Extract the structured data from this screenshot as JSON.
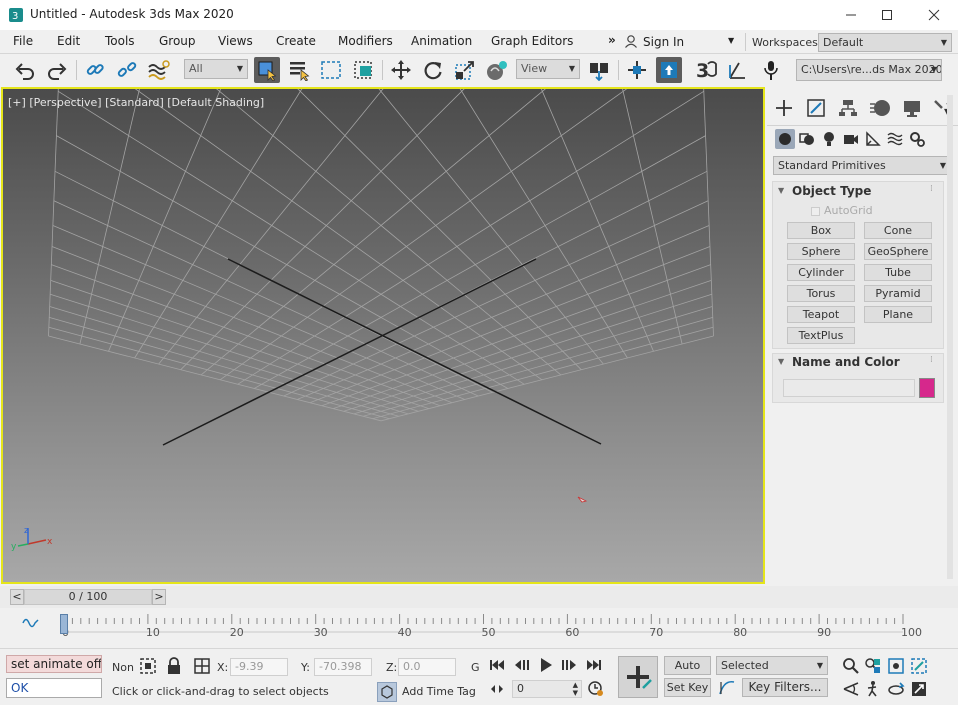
{
  "window": {
    "title": "Untitled - Autodesk 3ds Max 2020",
    "app_icon": "3ds-max-logo-icon"
  },
  "menu": {
    "items": [
      "File",
      "Edit",
      "Tools",
      "Group",
      "Views",
      "Create",
      "Modifiers",
      "Animation",
      "Graph Editors"
    ],
    "overflow": "»",
    "sign_in": "Sign In",
    "workspaces_label": "Workspaces:",
    "workspace_value": "Default"
  },
  "toolbar": {
    "selection_filter": "All",
    "ref_coord": "View",
    "path_field": "C:\\Users\\re...ds Max 2020"
  },
  "viewport": {
    "label_plus": "[+]",
    "label_view": "[Perspective]",
    "label_standard": "[Standard]",
    "label_shading": "[Default Shading]",
    "axis_x": "x",
    "axis_y": "y",
    "axis_z": "z",
    "highlight_color": "#e5e51a"
  },
  "command_panel": {
    "category": "Standard Primitives",
    "object_type_title": "Object Type",
    "autogrid": "AutoGrid",
    "buttons": [
      "Box",
      "Cone",
      "Sphere",
      "GeoSphere",
      "Cylinder",
      "Tube",
      "Torus",
      "Pyramid",
      "Teapot",
      "Plane",
      "TextPlus"
    ],
    "name_color_title": "Name and Color",
    "object_color": "#d6288c"
  },
  "timeline": {
    "slider_label": "0 / 100",
    "prev": "<",
    "next": ">",
    "ticks": [
      "0",
      "10",
      "20",
      "30",
      "40",
      "50",
      "60",
      "70",
      "80",
      "90",
      "100"
    ]
  },
  "status": {
    "maxscript_line1": "set animate off",
    "maxscript_line2": "OK",
    "selection_none": "None",
    "x_label": "X:",
    "x_value": "-9.39",
    "y_label": "Y:",
    "y_value": "-70.398",
    "z_label": "Z:",
    "z_value": "0.0",
    "g_label": "G",
    "prompt": "Click or click-and-drag to select objects",
    "add_time_tag": "Add Time Tag",
    "frame_value": "0",
    "auto_key": "Auto Key",
    "set_key": "Set Key",
    "key_mode": "Selected",
    "key_filters": "Key Filters..."
  }
}
